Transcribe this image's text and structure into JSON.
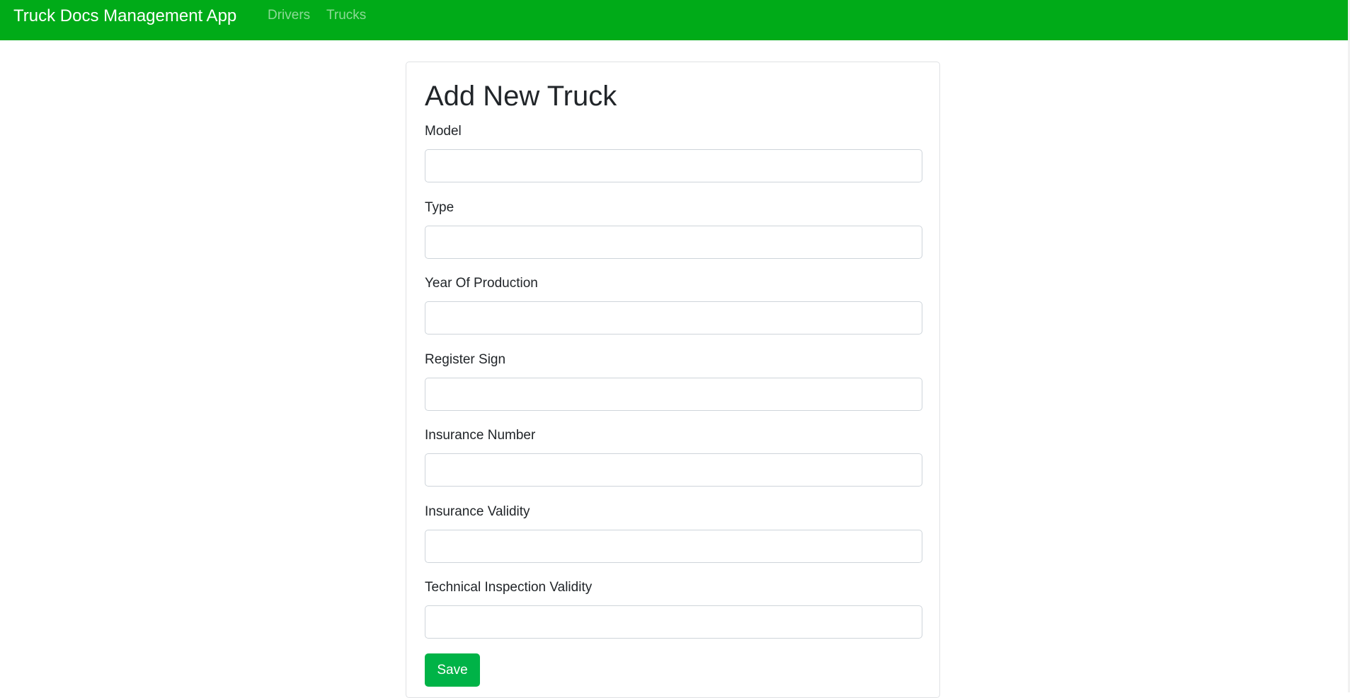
{
  "navbar": {
    "brand": "Truck Docs Management App",
    "links": [
      {
        "label": "Drivers"
      },
      {
        "label": "Trucks"
      }
    ],
    "background_color": "#00ab18"
  },
  "form": {
    "title": "Add New Truck",
    "fields": [
      {
        "label": "Model",
        "value": ""
      },
      {
        "label": "Type",
        "value": ""
      },
      {
        "label": "Year Of Production",
        "value": ""
      },
      {
        "label": "Register Sign",
        "value": ""
      },
      {
        "label": "Insurance Number",
        "value": ""
      },
      {
        "label": "Insurance Validity",
        "value": ""
      },
      {
        "label": "Technical Inspection Validity",
        "value": ""
      }
    ],
    "save_label": "Save",
    "save_color": "#00b347"
  }
}
